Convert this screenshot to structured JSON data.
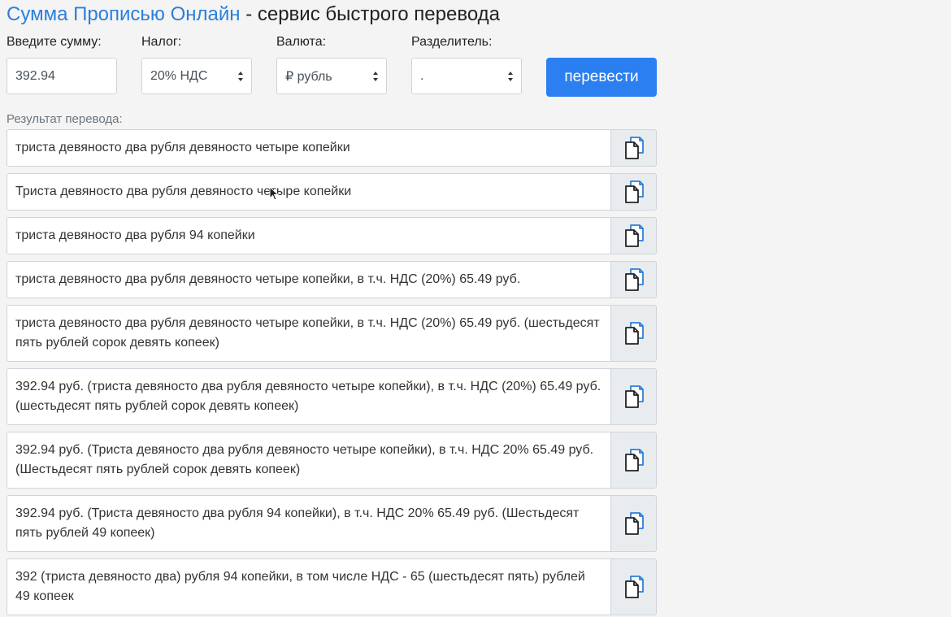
{
  "header": {
    "brand": "Сумма Прописью Онлайн",
    "subtitle": " - сервис быстрого перевода"
  },
  "form": {
    "amount_label": "Введите сумму:",
    "amount_value": "392.94",
    "tax_label": "Налог:",
    "tax_value": "20% НДС",
    "currency_label": "Валюта:",
    "currency_value": "₽ рубль",
    "separator_label": "Разделитель:",
    "separator_value": ".",
    "submit_label": "перевести"
  },
  "results": {
    "label": "Результат перевода:",
    "rows": [
      "триста девяносто два рубля девяносто четыре копейки",
      "Триста девяносто два рубля девяносто четыре копейки",
      "триста девяносто два рубля 94 копейки",
      "триста девяносто два рубля девяносто четыре копейки, в т.ч. НДС (20%) 65.49 руб.",
      "триста девяносто два рубля девяносто четыре копейки, в т.ч. НДС (20%) 65.49 руб. (шестьдесят пять рублей сорок девять копеек)",
      "392.94 руб. (триста девяносто два рубля девяносто четыре копейки), в т.ч. НДС (20%) 65.49 руб. (шестьдесят пять рублей сорок девять копеек)",
      "392.94 руб. (Триста девяносто два рубля девяносто четыре копейки), в т.ч. НДС 20% 65.49 руб. (Шестьдесят пять рублей сорок девять копеек)",
      "392.94 руб. (Триста девяносто два рубля 94 копейки), в т.ч. НДС 20% 65.49 руб. (Шестьдесят пять рублей 49 копеек)",
      "392 (триста девяносто два) рубля 94 копейки, в том числе НДС - 65 (шестьдесят пять) рублей 49 копеек"
    ]
  },
  "icons": {
    "copy": "copy-icon",
    "select": "chevron-updown-icon",
    "cursor": "mouse-cursor-icon"
  },
  "colors": {
    "brand": "#2b7fd9",
    "button": "#2b7ff0",
    "background": "#f4f4f4"
  }
}
